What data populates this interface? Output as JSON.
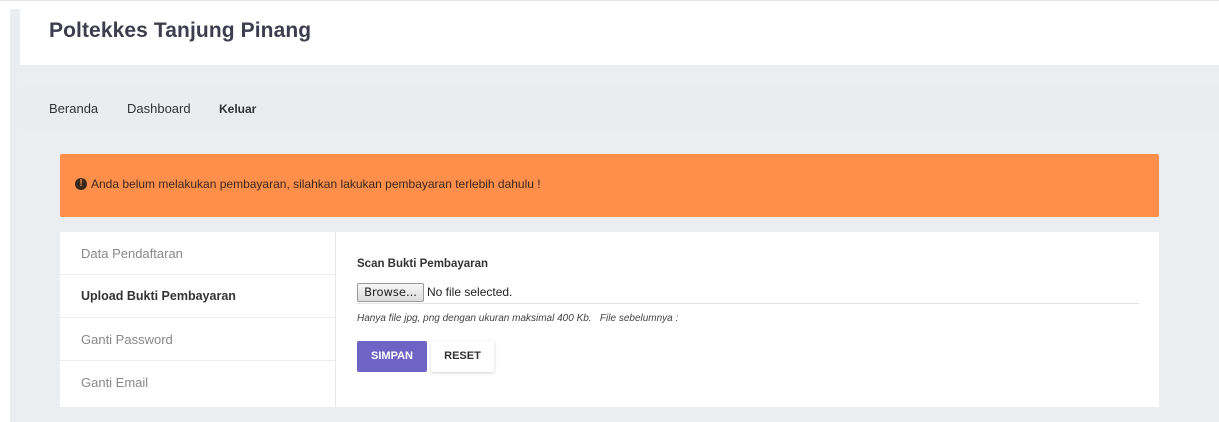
{
  "header": {
    "brand": "Poltekkes Tanjung Pinang"
  },
  "nav": {
    "items": [
      "Beranda",
      "Dashboard",
      "Keluar"
    ]
  },
  "alert": {
    "icon": "exclamation-circle-icon",
    "message": "Anda belum melakukan pembayaran, silahkan lakukan pembayaran terlebih dahulu !",
    "color": "#ff8f4b"
  },
  "sidebar": {
    "items": [
      {
        "label": "Data Pendaftaran"
      },
      {
        "label": "Upload Bukti Pembayaran"
      },
      {
        "label": "Ganti Password"
      },
      {
        "label": "Ganti Email"
      }
    ],
    "active": "Upload Bukti Pembayaran"
  },
  "form": {
    "field_label": "Scan Bukti Pembayaran",
    "browse_label": "Browse...",
    "file_status": "No file selected.",
    "hint": "Hanya file jpg, png dengan ukuran maksimal 400 Kb.   File sebelumnya :",
    "submit_label": "SIMPAN",
    "reset_label": "RESET",
    "submit_color": "#6f63c6"
  }
}
